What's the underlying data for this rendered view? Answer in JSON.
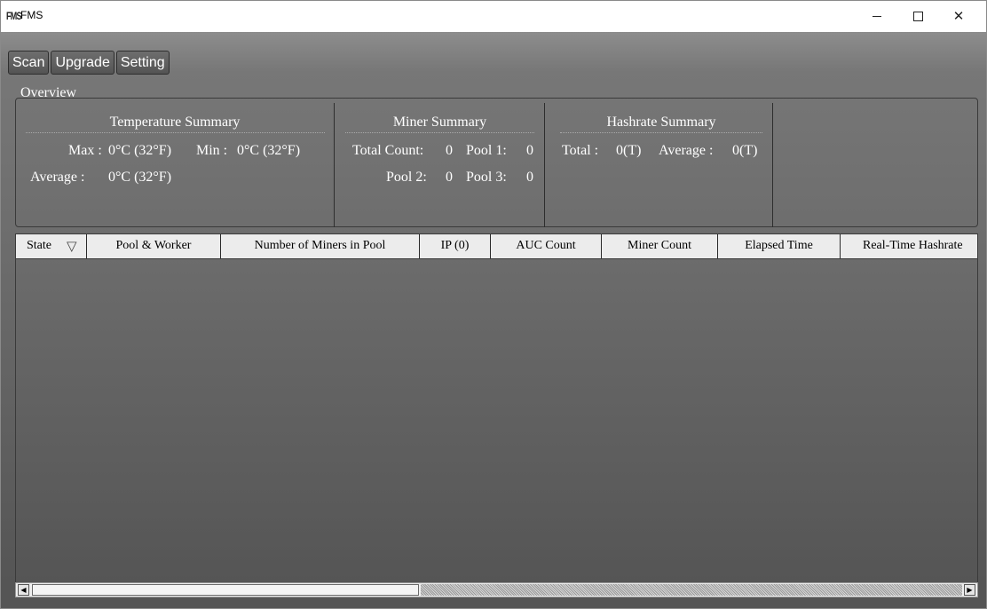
{
  "window": {
    "logo_text": "FMS",
    "title": "FMS",
    "controls": {
      "minimize": "minimize",
      "maximize": "maximize",
      "close": "✕"
    }
  },
  "toolbar": {
    "scan_label": "Scan",
    "upgrade_label": "Upgrade",
    "setting_label": "Setting"
  },
  "overview": {
    "legend": "Overview",
    "temperature": {
      "title": "Temperature Summary",
      "max_label": "Max :",
      "max_value": "0°C (32°F)",
      "min_label": "Min :",
      "min_value": "0°C (32°F)",
      "average_label": "Average :",
      "average_value": "0°C (32°F)"
    },
    "miner": {
      "title": "Miner Summary",
      "total_count_label": "Total Count:",
      "total_count_value": "0",
      "pool1_label": "Pool 1:",
      "pool1_value": "0",
      "pool2_label": "Pool 2:",
      "pool2_value": "0",
      "pool3_label": "Pool 3:",
      "pool3_value": "0"
    },
    "hashrate": {
      "title": "Hashrate Summary",
      "total_label": "Total :",
      "total_value": "0(T)",
      "average_label": "Average :",
      "average_value": "0(T)"
    }
  },
  "table": {
    "columns": [
      "State",
      "Pool & Worker",
      "Number of Miners in Pool",
      "IP (0)",
      "AUC Count",
      "Miner Count",
      "Elapsed Time",
      "Real-Time Hashrate"
    ],
    "sort_icon": "▽",
    "rows": []
  },
  "scrollbar": {
    "left_arrow": "◀",
    "right_arrow": "▶"
  }
}
